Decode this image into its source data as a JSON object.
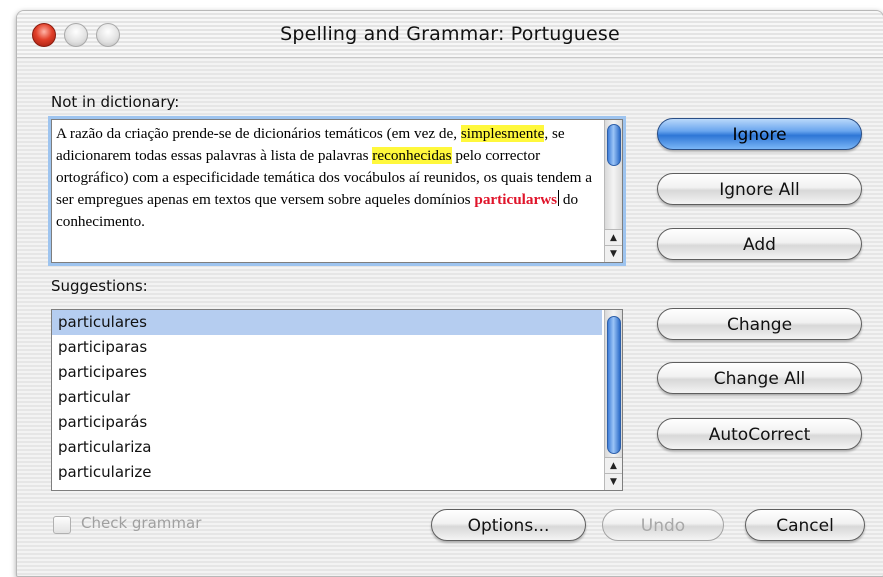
{
  "window": {
    "title": "Spelling and Grammar: Portuguese",
    "controls": [
      "close-button",
      "minimize-button",
      "zoom-button"
    ]
  },
  "not_in_dictionary": {
    "label": "Not in dictionary:",
    "segments": [
      {
        "text": "A razão da criação prende-se de dicionários temáticos (em vez de, ",
        "style": "normal"
      },
      {
        "text": "simplesmente",
        "style": "highlight"
      },
      {
        "text": ", se adicionarem todas essas palavras à lista de palavras ",
        "style": "normal"
      },
      {
        "text": "reconhecidas",
        "style": "highlight"
      },
      {
        "text": " pelo corrector ortográfico) com a especificidade temática dos vocábulos aí reunidos, os quais tendem a ser empregues apenas em textos que versem sobre aqueles domínios ",
        "style": "normal"
      },
      {
        "text": "particularws",
        "style": "error"
      },
      {
        "text": " do conhecimento.",
        "style": "normal"
      }
    ]
  },
  "suggestions": {
    "label": "Suggestions:",
    "selected": "particulares",
    "items": [
      "particulares",
      "participaras",
      "participares",
      "particular",
      "participarás",
      "particulariza",
      "particularize"
    ]
  },
  "buttons": {
    "ignore": "Ignore",
    "ignore_all": "Ignore All",
    "add": "Add",
    "change": "Change",
    "change_all": "Change All",
    "autocorrect": "AutoCorrect",
    "options": "Options...",
    "undo": "Undo",
    "cancel": "Cancel"
  },
  "check_grammar": {
    "label": "Check grammar",
    "checked": false,
    "enabled": false
  },
  "colors": {
    "highlight": "#fff83c",
    "error_text": "#e0142a",
    "default_button": "#2e76d6",
    "selection": "#b5cdf0"
  }
}
